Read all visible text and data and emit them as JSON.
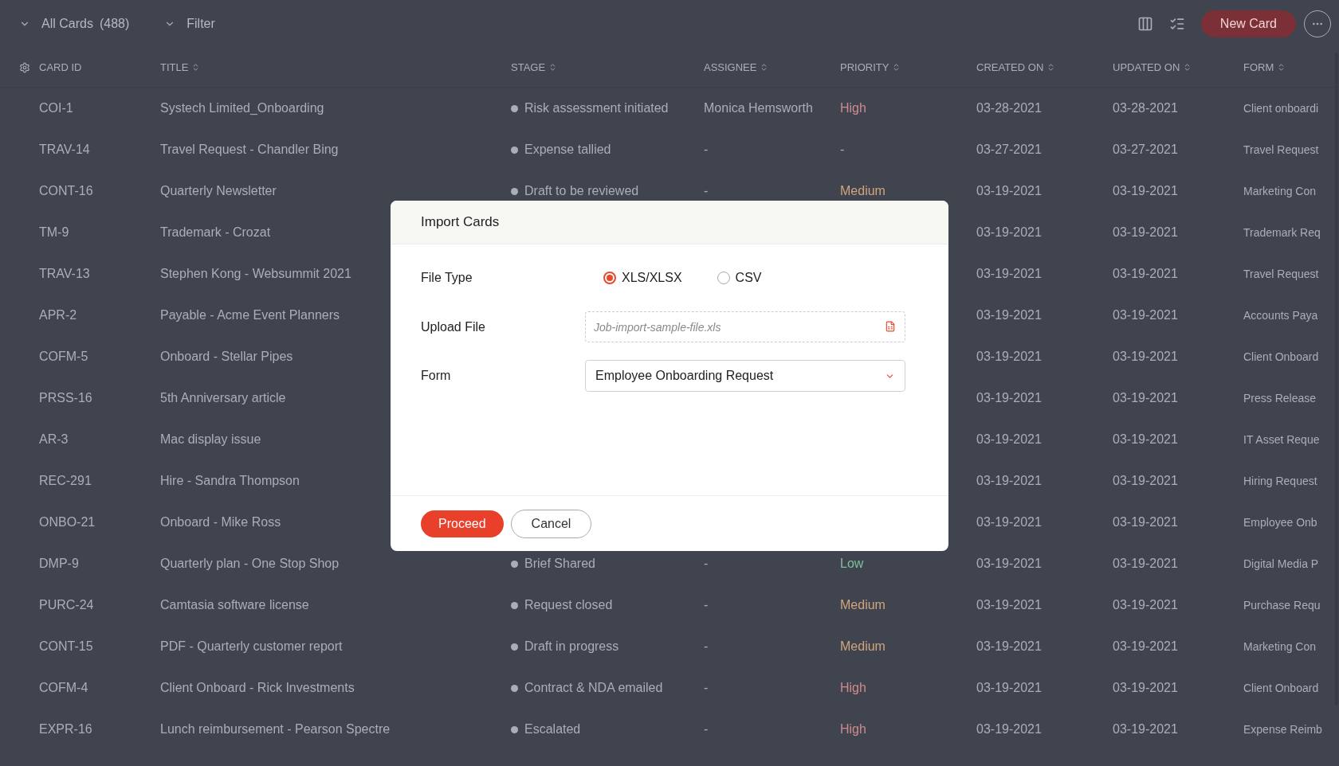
{
  "toolbar": {
    "view_label": "All Cards",
    "count": "(488)",
    "filter_label": "Filter",
    "new_button": "New Card"
  },
  "table": {
    "columns": [
      "CARD ID",
      "TITLE",
      "STAGE",
      "ASSIGNEE",
      "PRIORITY",
      "CREATED ON",
      "UPDATED ON",
      "FORM"
    ],
    "rows": [
      {
        "card_id": "COI-1",
        "title": "Systech Limited_Onboarding",
        "stage": "Risk assessment initiated",
        "assignee": "Monica Hemsworth",
        "priority": {
          "text": "High",
          "color": "#d08a8f"
        },
        "created": "03-28-2021",
        "updated": "03-28-2021",
        "form": "Client onboardi"
      },
      {
        "card_id": "TRAV-14",
        "title": "Travel Request - Chandler Bing",
        "stage": "Expense tallied",
        "assignee": "-",
        "priority": {
          "text": "-"
        },
        "created": "03-27-2021",
        "updated": "03-27-2021",
        "form": "Travel Request"
      },
      {
        "card_id": "CONT-16",
        "title": "Quarterly Newsletter",
        "stage": "Draft to be reviewed",
        "assignee": "-",
        "priority": {
          "text": "Medium",
          "color": "#d0a47c"
        },
        "created": "03-19-2021",
        "updated": "03-19-2021",
        "form": "Marketing Con"
      },
      {
        "card_id": "TM-9",
        "title": "Trademark - Crozat",
        "created": "03-19-2021",
        "updated": "03-19-2021",
        "form": "Trademark Req"
      },
      {
        "card_id": "TRAV-13",
        "title": "Stephen Kong - Websummit 2021",
        "created": "03-19-2021",
        "updated": "03-19-2021",
        "form": "Travel Request"
      },
      {
        "card_id": "APR-2",
        "title": "Payable - Acme Event Planners",
        "created": "03-19-2021",
        "updated": "03-19-2021",
        "form": "Accounts Paya"
      },
      {
        "card_id": "COFM-5",
        "title": "Onboard - Stellar Pipes",
        "created": "03-19-2021",
        "updated": "03-19-2021",
        "form": "Client Onboard"
      },
      {
        "card_id": "PRSS-16",
        "title": "5th Anniversary article",
        "created": "03-19-2021",
        "updated": "03-19-2021",
        "form": "Press Release"
      },
      {
        "card_id": "AR-3",
        "title": "Mac display issue",
        "created": "03-19-2021",
        "updated": "03-19-2021",
        "form": "IT Asset Reque"
      },
      {
        "card_id": "REC-291",
        "title": "Hire - Sandra Thompson",
        "created": "03-19-2021",
        "updated": "03-19-2021",
        "form": "Hiring Request"
      },
      {
        "card_id": "ONBO-21",
        "title": "Onboard - Mike Ross",
        "created": "03-19-2021",
        "updated": "03-19-2021",
        "form": "Employee Onb"
      },
      {
        "card_id": "DMP-9",
        "title": "Quarterly plan - One Stop Shop",
        "stage": "Brief Shared",
        "assignee": "-",
        "priority": {
          "text": "Low",
          "color": "#7fbf9e"
        },
        "created": "03-19-2021",
        "updated": "03-19-2021",
        "form": "Digital Media P"
      },
      {
        "card_id": "PURC-24",
        "title": "Camtasia software license",
        "stage": "Request closed",
        "assignee": "-",
        "priority": {
          "text": "Medium",
          "color": "#d0a47c"
        },
        "created": "03-19-2021",
        "updated": "03-19-2021",
        "form": "Purchase Requ"
      },
      {
        "card_id": "CONT-15",
        "title": "PDF - Quarterly customer report",
        "stage": "Draft in progress",
        "assignee": "-",
        "priority": {
          "text": "Medium",
          "color": "#d0a47c"
        },
        "created": "03-19-2021",
        "updated": "03-19-2021",
        "form": "Marketing Con"
      },
      {
        "card_id": "COFM-4",
        "title": "Client Onboard - Rick Investments",
        "stage": "Contract & NDA emailed",
        "assignee": "-",
        "priority": {
          "text": "High",
          "color": "#d08a8f"
        },
        "created": "03-19-2021",
        "updated": "03-19-2021",
        "form": "Client Onboard"
      },
      {
        "card_id": "EXPR-16",
        "title": "Lunch reimbursement - Pearson Spectre",
        "stage": "Escalated",
        "assignee": "-",
        "priority": {
          "text": "High",
          "color": "#d08a8f"
        },
        "created": "03-19-2021",
        "updated": "03-19-2021",
        "form": "Expense Reimb"
      }
    ]
  },
  "dialog": {
    "title": "Import Cards",
    "file_type": {
      "label": "File Type",
      "options": [
        {
          "label": "XLS/XLSX",
          "selected": true
        },
        {
          "label": "CSV",
          "selected": false
        }
      ]
    },
    "upload": {
      "label": "Upload File",
      "placeholder": "Job-import-sample-file.xls"
    },
    "form": {
      "label": "Form",
      "value": "Employee Onboarding Request"
    },
    "buttons": {
      "proceed": "Proceed",
      "cancel": "Cancel"
    }
  }
}
